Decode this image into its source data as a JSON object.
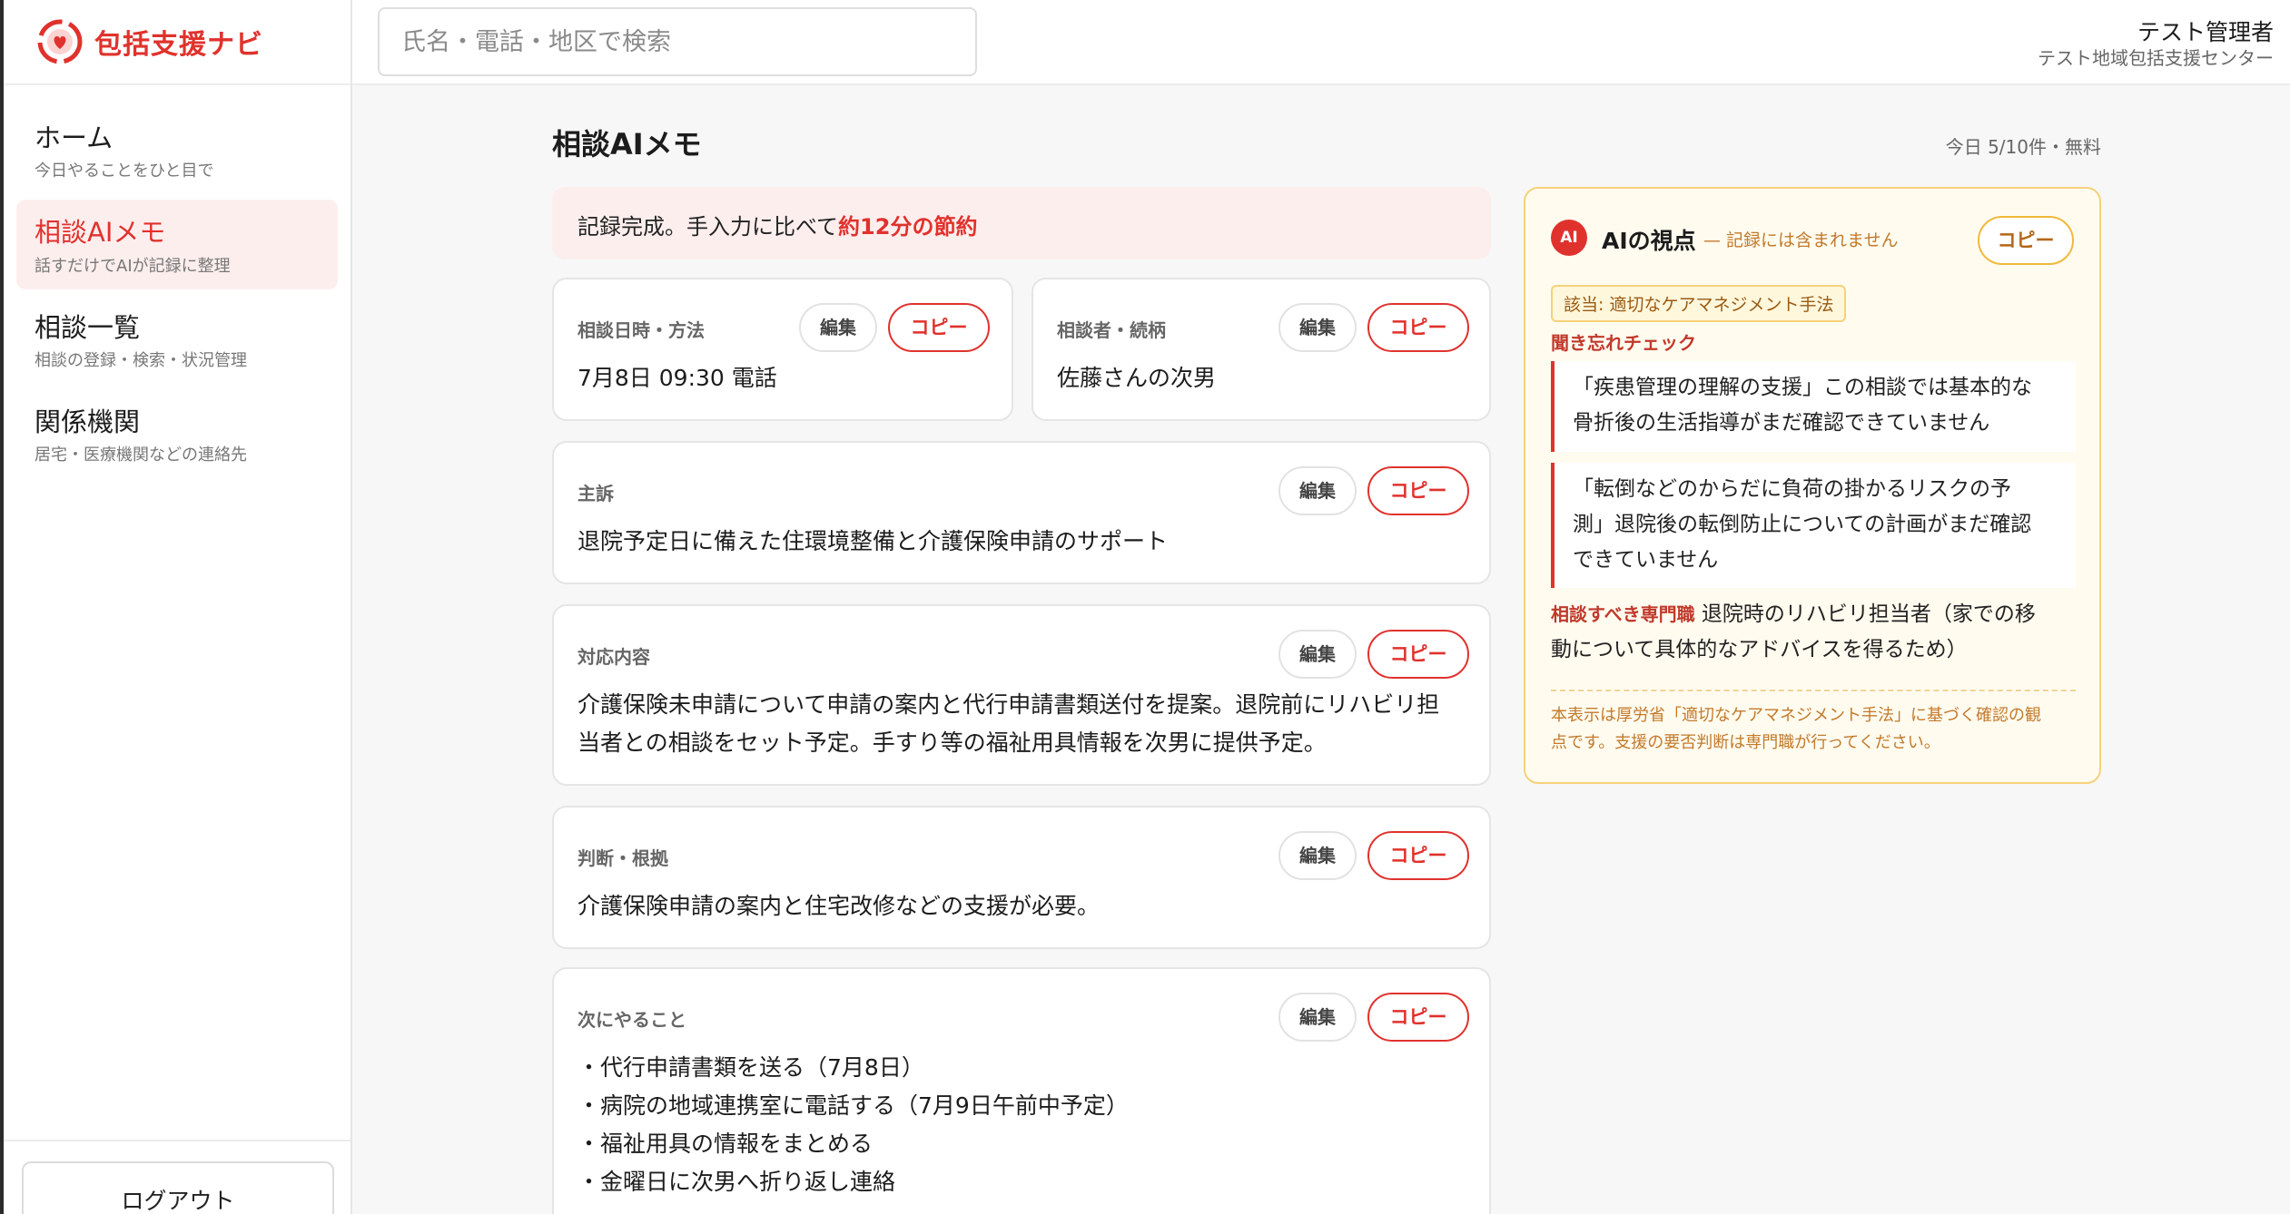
{
  "app": {
    "logo_text": "包括支援ナビ"
  },
  "header": {
    "search_placeholder": "氏名・電話・地区で検索",
    "user_name": "テスト管理者",
    "user_org": "テスト地域包括支援センター"
  },
  "sidebar": {
    "items": [
      {
        "title": "ホーム",
        "sub": "今日やることをひと目で"
      },
      {
        "title": "相談AIメモ",
        "sub": "話すだけでAIが記録に整理"
      },
      {
        "title": "相談一覧",
        "sub": "相談の登録・検索・状況管理"
      },
      {
        "title": "関係機関",
        "sub": "居宅・医療機関などの連絡先"
      }
    ],
    "logout_label": "ログアウト"
  },
  "main": {
    "title": "相談AIメモ",
    "usage": "今日 5/10件・無料",
    "banner_prefix": "記録完成。手入力に比べて",
    "banner_highlight": "約12分の節約",
    "edit_label": "編集",
    "copy_label": "コピー",
    "cards": {
      "datetime": {
        "label": "相談日時・方法",
        "value": "7月8日 09:30 電話"
      },
      "person": {
        "label": "相談者・続柄",
        "value": "佐藤さんの次男"
      },
      "complaint": {
        "label": "主訴",
        "value": "退院予定日に備えた住環境整備と介護保険申請のサポート"
      },
      "response": {
        "label": "対応内容",
        "line1": "介護保険未申請について申請の案内と代行申請書類送付を提案。退院前にリハビリ担",
        "line2": "当者との相談をセット予定。手すり等の福祉用具情報を次男に提供予定。"
      },
      "judgment": {
        "label": "判断・根拠",
        "value": "介護保険申請の案内と住宅改修などの支援が必要。"
      },
      "next": {
        "label": "次にやること",
        "items": [
          "・代行申請書類を送る（7月8日）",
          "・病院の地域連携室に電話する（7月9日午前中予定）",
          "・福祉用具の情報をまとめる",
          "・金曜日に次男へ折り返し連絡"
        ]
      }
    }
  },
  "ai_panel": {
    "badge": "AI",
    "title": "AIの視点",
    "note": "— 記録には含まれません",
    "copy_label": "コピー",
    "tag": "該当: 適切なケアマネジメント手法",
    "check_heading": "聞き忘れチェック",
    "checks": [
      {
        "line1": "「疾患管理の理解の支援」この相談では基本的な",
        "line2": "骨折後の生活指導がまだ確認できていません"
      },
      {
        "line1": "「転倒などのからだに負荷の掛かるリスクの予",
        "line2": "測」退院後の転倒防止についての計画がまだ確認",
        "line3": "できていません"
      }
    ],
    "pro_key": "相談すべき専門職",
    "pro_line1": " 退院時のリハビリ担当者（家での移",
    "pro_line2": "動について具体的なアドバイスを得るため）",
    "footer_line1": "本表示は厚労省「適切なケアマネジメント手法」に基づく確認の観",
    "footer_line2": "点です。支援の要否判断は専門職が行ってください。"
  },
  "colors": {
    "accent": "#e0322d",
    "ai_border": "#f4d27a",
    "ai_bg": "#fffbef"
  },
  "icons": {
    "logo": "heart-hands-logo-icon"
  }
}
